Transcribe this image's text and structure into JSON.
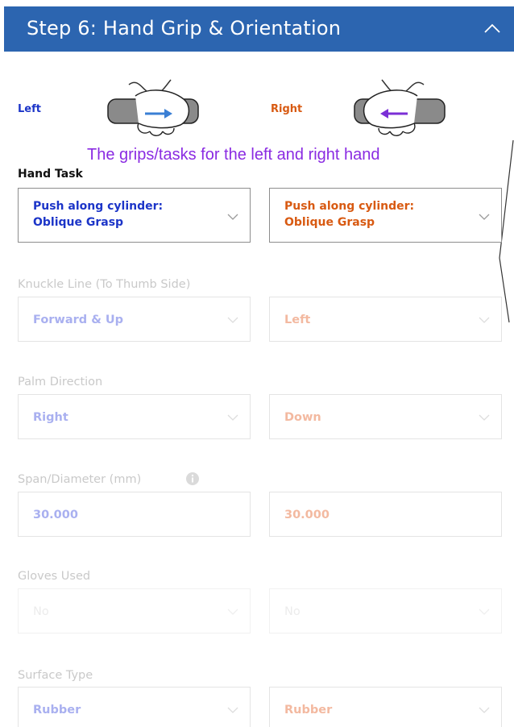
{
  "header": {
    "title": "Step 6: Hand Grip & Orientation"
  },
  "hands": {
    "left_label": "Left",
    "right_label": "Right"
  },
  "annotation": "The grips/tasks for the left and right hand",
  "fields": {
    "hand_task": {
      "label": "Hand Task",
      "left_value": "Push along cylinder:\nOblique Grasp",
      "right_value": "Push along cylinder:\nOblique Grasp"
    },
    "knuckle_line": {
      "label": "Knuckle Line (To Thumb Side)",
      "left_value": "Forward & Up",
      "right_value": "Left"
    },
    "palm_direction": {
      "label": "Palm Direction",
      "left_value": "Right",
      "right_value": "Down"
    },
    "span_diameter": {
      "label": "Span/Diameter (mm)",
      "left_value": "30.000",
      "right_value": "30.000"
    },
    "gloves_used": {
      "label": "Gloves Used",
      "left_value": "No",
      "right_value": "No"
    },
    "surface_type": {
      "label": "Surface Type",
      "left_value": "Rubber",
      "right_value": "Rubber"
    }
  },
  "colors": {
    "header_bg": "#2c65b0",
    "left_accent": "#1c35c8",
    "right_accent": "#d85a12",
    "annotation": "#8a2be2"
  },
  "icons": [
    "chevron-up-icon",
    "left-hand-grip-icon",
    "right-hand-grip-icon",
    "chevron-down-icon",
    "info-icon"
  ]
}
